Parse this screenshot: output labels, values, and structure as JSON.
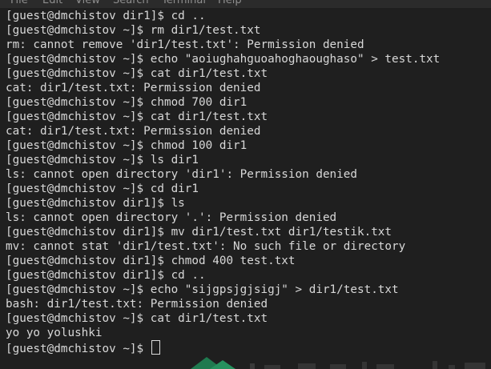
{
  "menu": {
    "items": [
      "File",
      "Edit",
      "View",
      "Search",
      "Terminal",
      "Help"
    ]
  },
  "terminal": {
    "lines": [
      "[guest@dmchistov dir1]$ cd ..",
      "[guest@dmchistov ~]$ rm dir1/test.txt",
      "rm: cannot remove 'dir1/test.txt': Permission denied",
      "[guest@dmchistov ~]$ echo \"aoiughahguoahoghaoughaso\" > test.txt",
      "[guest@dmchistov ~]$ cat dir1/test.txt",
      "cat: dir1/test.txt: Permission denied",
      "[guest@dmchistov ~]$ chmod 700 dir1",
      "[guest@dmchistov ~]$ cat dir1/test.txt",
      "cat: dir1/test.txt: Permission denied",
      "[guest@dmchistov ~]$ chmod 100 dir1",
      "[guest@dmchistov ~]$ ls dir1",
      "ls: cannot open directory 'dir1': Permission denied",
      "[guest@dmchistov ~]$ cd dir1",
      "[guest@dmchistov dir1]$ ls",
      "ls: cannot open directory '.': Permission denied",
      "[guest@dmchistov dir1]$ mv dir1/test.txt dir1/testik.txt",
      "mv: cannot stat 'dir1/test.txt': No such file or directory",
      "[guest@dmchistov dir1]$ chmod 400 test.txt",
      "[guest@dmchistov dir1]$ cd ..",
      "[guest@dmchistov ~]$ echo \"sijgpsjgjsigj\" > dir1/test.txt",
      "bash: dir1/test.txt: Permission denied",
      "[guest@dmchistov ~]$ cat dir1/test.txt",
      "yo yo yolushki"
    ],
    "prompt": "[guest@dmchistov ~]$ "
  },
  "colors": {
    "background": "#1f1f1f",
    "text": "#d8d8d8",
    "menubar": "#2b2b2b",
    "menu_text": "#8e8e8e"
  }
}
